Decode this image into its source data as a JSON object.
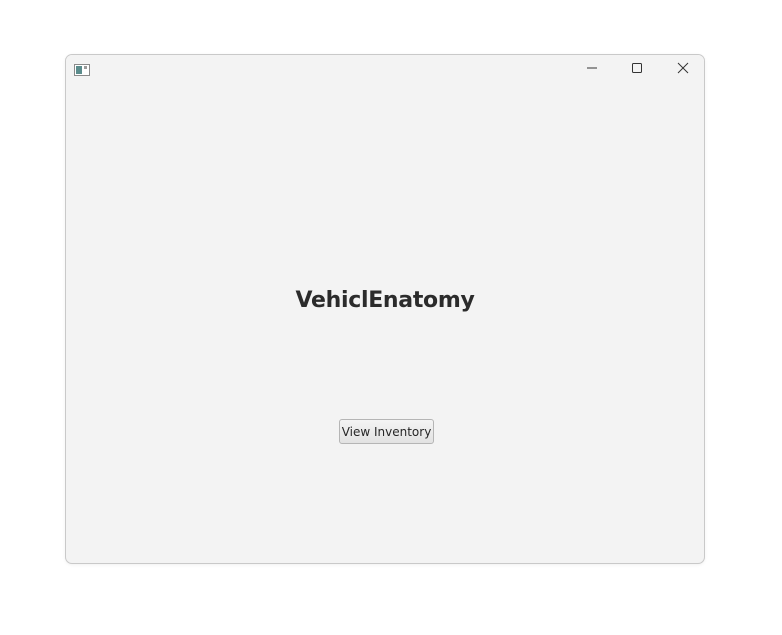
{
  "window": {
    "app_icon": "app-window-icon",
    "controls": {
      "minimize_icon": "minimize-icon",
      "maximize_icon": "maximize-icon",
      "close_icon": "close-icon"
    }
  },
  "main": {
    "title": "VehiclEnatomy",
    "view_inventory_label": "View Inventory"
  },
  "colors": {
    "window_bg": "#f3f3f3",
    "title_text": "#2b2b2b"
  }
}
